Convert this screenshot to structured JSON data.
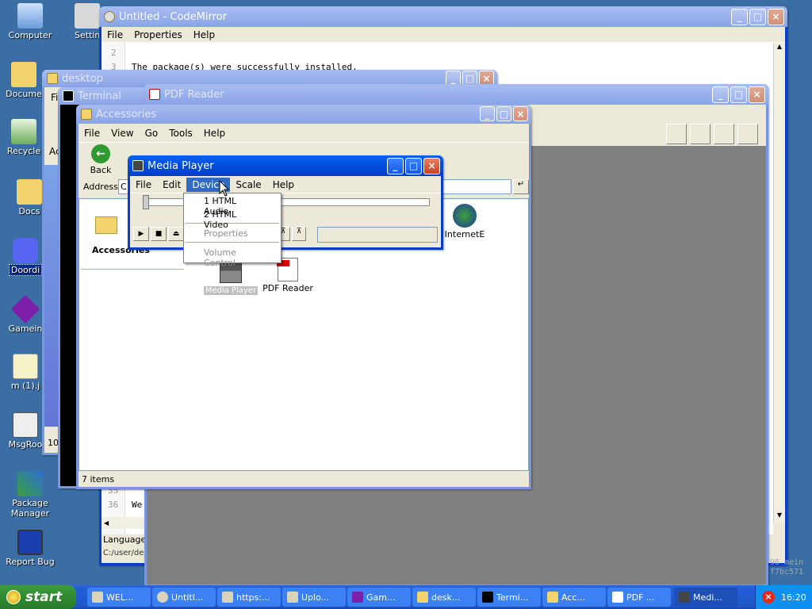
{
  "desktop": {
    "icons": [
      {
        "label": "Computer"
      },
      {
        "label": "Settin"
      },
      {
        "label": "Docume"
      },
      {
        "label": "Recycle"
      },
      {
        "label": "Docs"
      },
      {
        "label": "Doordi"
      },
      {
        "label": "Gamein"
      },
      {
        "label": "m (1).j"
      },
      {
        "label": "MsgRoo"
      },
      {
        "label": "Package Manager"
      },
      {
        "label": "Report Bug"
      }
    ]
  },
  "codemirror": {
    "title": "Untitled - CodeMirror",
    "menu": [
      "File",
      "Properties",
      "Help"
    ],
    "lines": [
      {
        "num": "2",
        "text": ""
      },
      {
        "num": "3",
        "text": "The package(s) were successfully installed."
      }
    ],
    "bottom_lines": [
      {
        "num": "35",
        "text": ""
      },
      {
        "num": "36",
        "text": "We"
      }
    ],
    "status_language": "Language: J",
    "status_path": "C:/user/de",
    "right_hex": [
      "96 mein",
      "f7bc571"
    ]
  },
  "desktop_window": {
    "title": "desktop",
    "menu_first": "Fi",
    "side_text": "Ac",
    "status": "10 i"
  },
  "terminal": {
    "title": "Terminal"
  },
  "pdf_reader": {
    "title": "PDF Reader"
  },
  "accessories": {
    "title": "Accessories",
    "menu": [
      "File",
      "View",
      "Go",
      "Tools",
      "Help"
    ],
    "back_label": "Back",
    "address_label": "Address",
    "address_value": "C",
    "side_title": "Accessories",
    "items": [
      {
        "label": "InternetE"
      },
      {
        "label": "Media Player"
      },
      {
        "label": "PDF Reader"
      }
    ],
    "status": "7 items"
  },
  "media_player": {
    "title": "Media Player",
    "menu": [
      "File",
      "Edit",
      "Device",
      "Scale",
      "Help"
    ],
    "active_menu": "Device",
    "device_menu": {
      "items": [
        "1 HTML Audio",
        "2 HTML Video"
      ],
      "disabled": [
        "Properties",
        "Volume Control"
      ]
    }
  },
  "taskbar": {
    "start_label": "start",
    "tasks": [
      {
        "label": "WEL..."
      },
      {
        "label": "Untitl..."
      },
      {
        "label": "https:..."
      },
      {
        "label": "Uplo..."
      },
      {
        "label": "Gam..."
      },
      {
        "label": "desk..."
      },
      {
        "label": "Termi..."
      },
      {
        "label": "Acc..."
      },
      {
        "label": "PDF ..."
      },
      {
        "label": "Medi..."
      }
    ],
    "clock": "16:20"
  }
}
